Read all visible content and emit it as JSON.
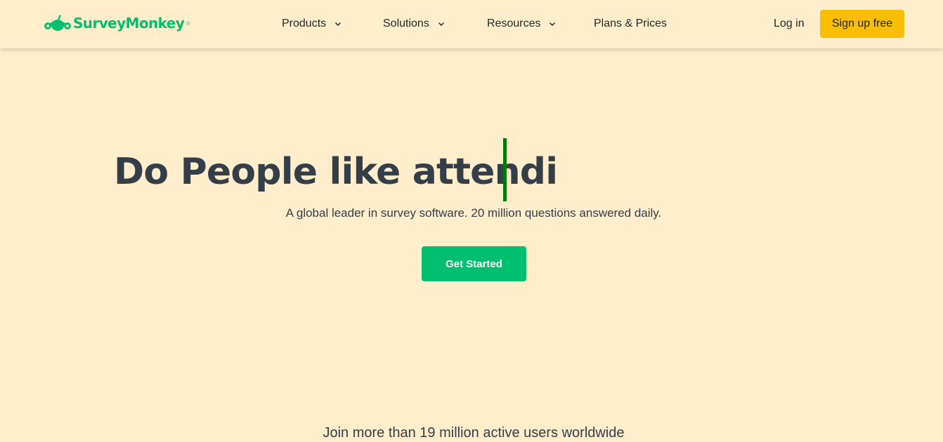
{
  "brand": {
    "name": "SurveyMonkey",
    "registered_mark": "®",
    "logo_icon": "monkey-logo-icon",
    "color": "#00BF6F"
  },
  "nav": {
    "items": [
      {
        "label": "Products",
        "has_dropdown": true
      },
      {
        "label": "Solutions",
        "has_dropdown": true
      },
      {
        "label": "Resources",
        "has_dropdown": true
      },
      {
        "label": "Plans & Prices",
        "has_dropdown": false
      }
    ],
    "login_label": "Log in",
    "signup_label": "Sign up free",
    "signup_color": "#F9BE00"
  },
  "hero": {
    "headline_typed": "Do People like attendi",
    "subheadline": "A global leader in survey software. 20 million questions answered daily.",
    "cta_label": "Get Started",
    "cta_color": "#00BF6F",
    "cursor_color": "#047A04"
  },
  "social_proof": {
    "text": "Join more than 19 million active users worldwide"
  },
  "colors": {
    "background": "#FFEDCB",
    "text": "#333E48"
  }
}
